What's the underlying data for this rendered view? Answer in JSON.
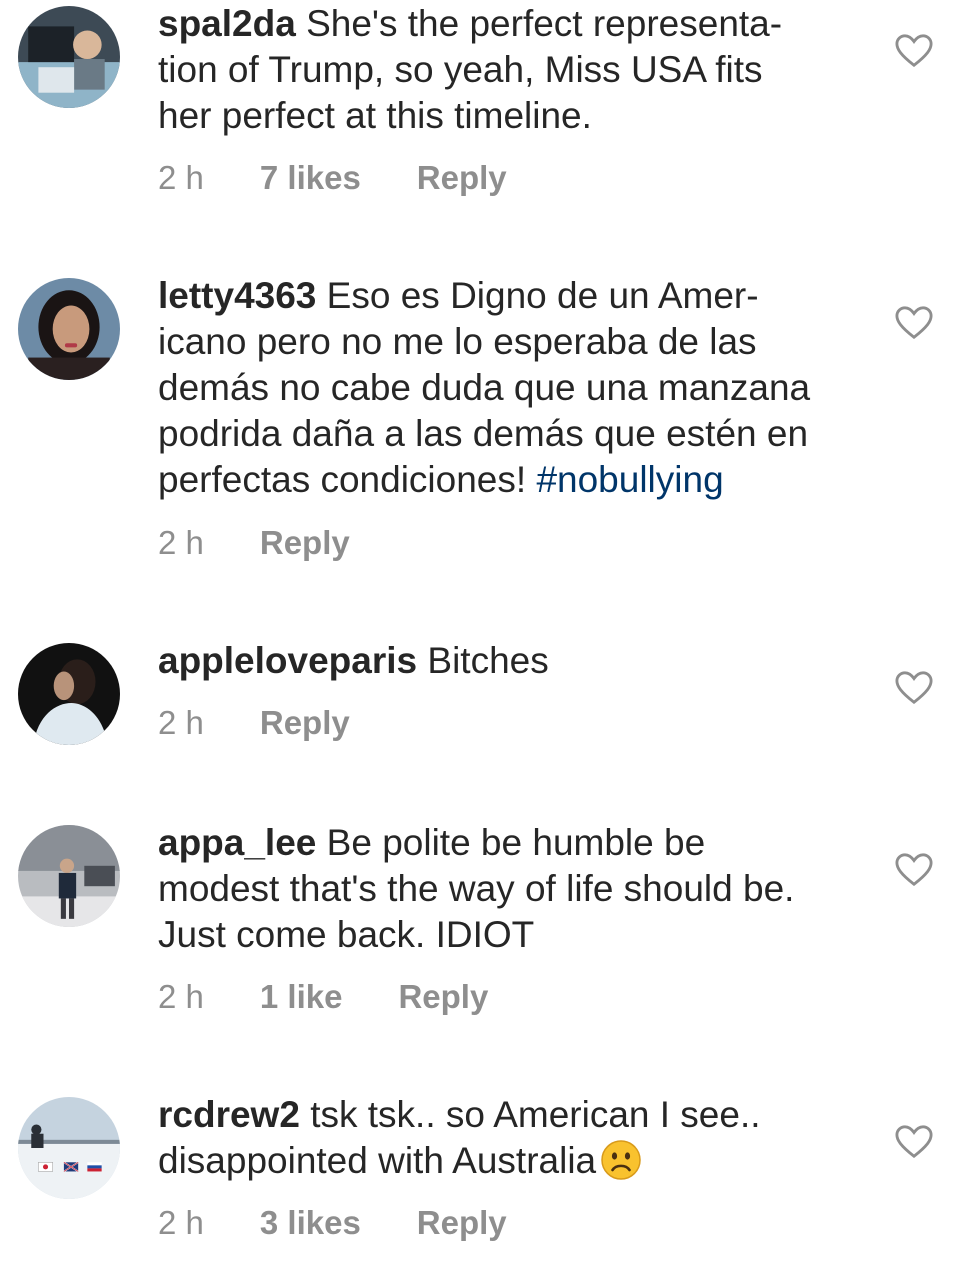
{
  "comments": [
    {
      "username": "spal2da",
      "text": "She's the perfect representa-\ntion of Trump, so yeah, Miss USA fits\nher perfect at this timeline.",
      "time": "2 h",
      "likes": "7 likes",
      "reply": "Reply"
    },
    {
      "username": "letty4363",
      "text": "Eso es Digno de un Amer-\nicano pero no me lo esperaba de las\ndemás no cabe duda que una manzana\npodrida daña a las demás que estén en\nperfectas condiciones! ",
      "hashtag": "#nobullying",
      "time": "2 h",
      "reply": "Reply"
    },
    {
      "username": "appleloveparis",
      "text": "Bitches",
      "time": "2 h",
      "reply": "Reply"
    },
    {
      "username": "appa_lee",
      "text": "Be polite be humble be\nmodest that's the way of life should be.\nJust come back. IDIOT",
      "time": "2 h",
      "likes": "1 like",
      "reply": "Reply"
    },
    {
      "username": "rcdrew2",
      "text": "tsk tsk.. so American I see..\ndisappointed with Australia",
      "emoji": "frowning-face",
      "time": "2 h",
      "likes": "3 likes",
      "reply": "Reply"
    }
  ],
  "colors": {
    "text": "#262626",
    "meta": "#8e8e8e",
    "hashtag": "#003569",
    "emoji": "#f9c22e"
  }
}
